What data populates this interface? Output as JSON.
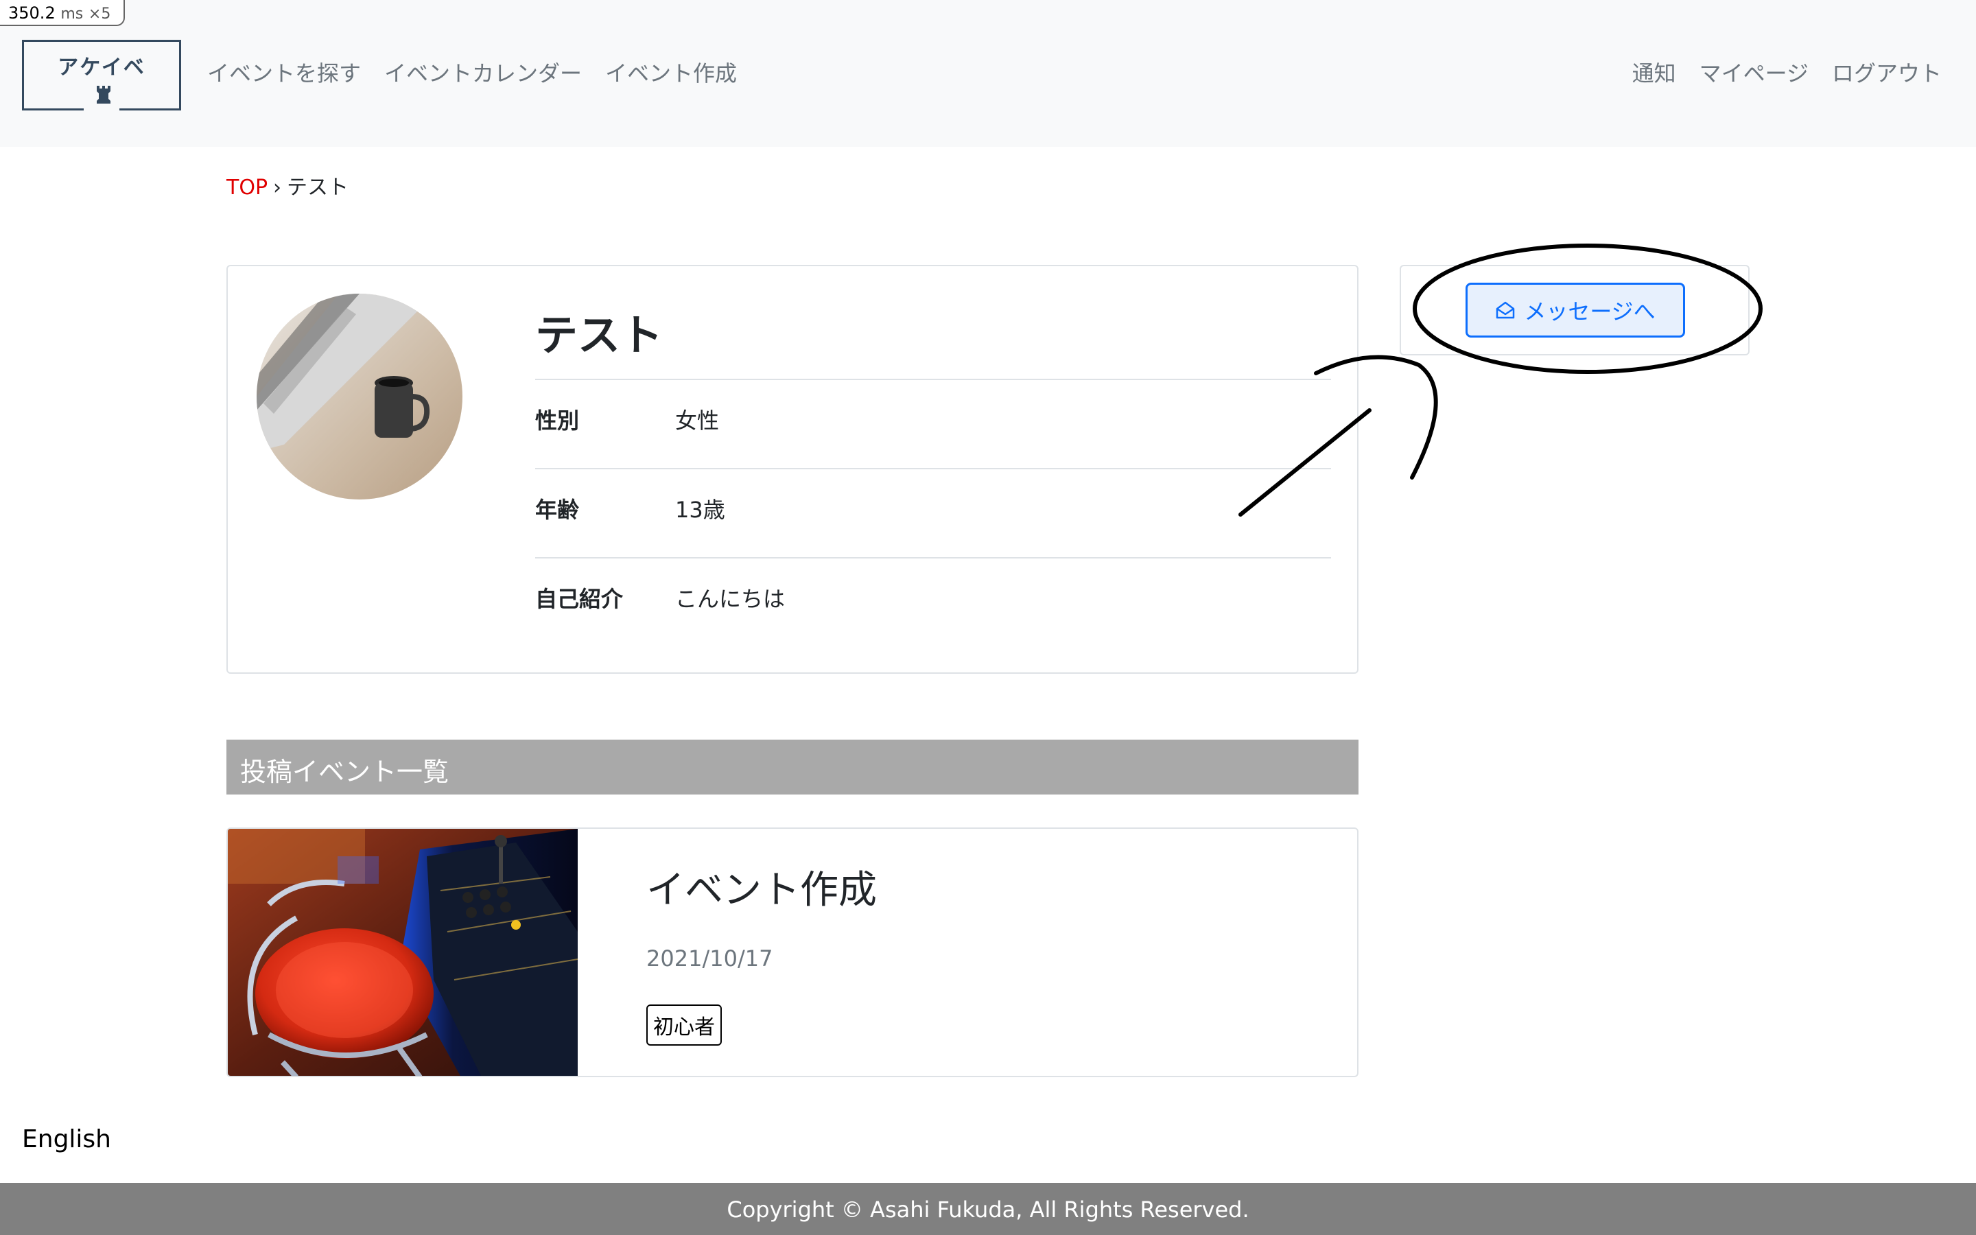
{
  "perf": {
    "value": "350.2",
    "unit": "ms",
    "multiplier": "×5"
  },
  "header": {
    "logo_text": "アケイベ",
    "nav_left": [
      "イベントを探す",
      "イベントカレンダー",
      "イベント作成"
    ],
    "nav_right": [
      "通知",
      "マイページ",
      "ログアウト"
    ]
  },
  "breadcrumb": {
    "top": "TOP",
    "separator": "›",
    "current": "テスト"
  },
  "profile": {
    "name": "テスト",
    "rows": [
      {
        "label": "性別",
        "value": "女性"
      },
      {
        "label": "年齢",
        "value": "13歳"
      },
      {
        "label": "自己紹介",
        "value": "こんにちは"
      }
    ]
  },
  "side": {
    "message_button": "メッセージへ",
    "icon": "envelope-open-icon"
  },
  "events_section": {
    "title": "投稿イベント一覧",
    "items": [
      {
        "title": "イベント作成",
        "date": "2021/10/17",
        "tag": "初心者"
      }
    ]
  },
  "language_link": "English",
  "footer": {
    "copyright": "Copyright © Asahi Fukuda, All Rights Reserved."
  },
  "colors": {
    "accent": "#0d6efd",
    "breadcrumb_link": "#e00000",
    "section_bar": "#a9a9a9",
    "footer_bg": "#808080",
    "navbar_bg": "#f8f9fa"
  }
}
